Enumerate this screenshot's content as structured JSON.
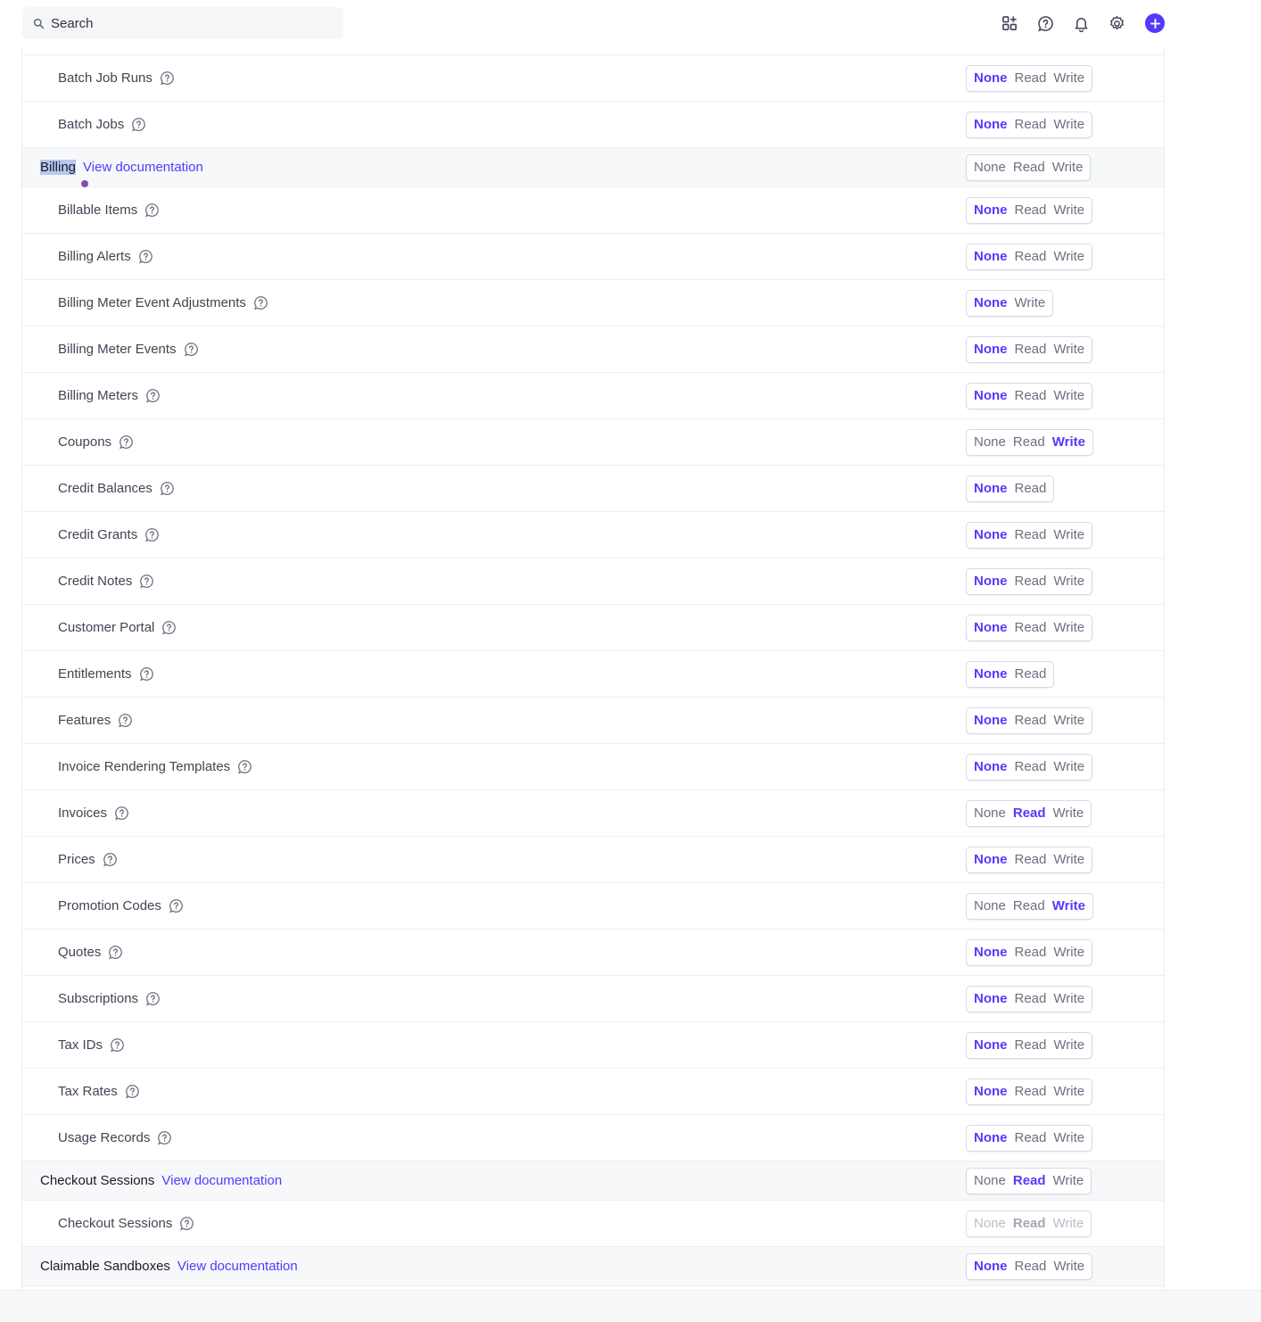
{
  "search": {
    "placeholder": "Search"
  },
  "topbar_icons": [
    "apps-icon",
    "help-icon",
    "bell-icon",
    "gear-icon",
    "plus-icon"
  ],
  "accent_color": "#533afd",
  "rows": [
    {
      "type": "item",
      "label": "Batch Job Runs",
      "options": [
        "None",
        "Read",
        "Write"
      ],
      "selected": "None"
    },
    {
      "type": "item",
      "label": "Batch Jobs",
      "options": [
        "None",
        "Read",
        "Write"
      ],
      "selected": "None"
    },
    {
      "type": "group",
      "label": "Billing",
      "link": "View documentation",
      "options": [
        "None",
        "Read",
        "Write"
      ],
      "selected": "",
      "highlighted": true
    },
    {
      "type": "item",
      "label": "Billable Items",
      "options": [
        "None",
        "Read",
        "Write"
      ],
      "selected": "None"
    },
    {
      "type": "item",
      "label": "Billing Alerts",
      "options": [
        "None",
        "Read",
        "Write"
      ],
      "selected": "None"
    },
    {
      "type": "item",
      "label": "Billing Meter Event Adjustments",
      "options": [
        "None",
        "Write"
      ],
      "selected": "None"
    },
    {
      "type": "item",
      "label": "Billing Meter Events",
      "options": [
        "None",
        "Read",
        "Write"
      ],
      "selected": "None"
    },
    {
      "type": "item",
      "label": "Billing Meters",
      "options": [
        "None",
        "Read",
        "Write"
      ],
      "selected": "None"
    },
    {
      "type": "item",
      "label": "Coupons",
      "options": [
        "None",
        "Read",
        "Write"
      ],
      "selected": "Write"
    },
    {
      "type": "item",
      "label": "Credit Balances",
      "options": [
        "None",
        "Read"
      ],
      "selected": "None"
    },
    {
      "type": "item",
      "label": "Credit Grants",
      "options": [
        "None",
        "Read",
        "Write"
      ],
      "selected": "None"
    },
    {
      "type": "item",
      "label": "Credit Notes",
      "options": [
        "None",
        "Read",
        "Write"
      ],
      "selected": "None"
    },
    {
      "type": "item",
      "label": "Customer Portal",
      "options": [
        "None",
        "Read",
        "Write"
      ],
      "selected": "None"
    },
    {
      "type": "item",
      "label": "Entitlements",
      "options": [
        "None",
        "Read"
      ],
      "selected": "None"
    },
    {
      "type": "item",
      "label": "Features",
      "options": [
        "None",
        "Read",
        "Write"
      ],
      "selected": "None"
    },
    {
      "type": "item",
      "label": "Invoice Rendering Templates",
      "options": [
        "None",
        "Read",
        "Write"
      ],
      "selected": "None"
    },
    {
      "type": "item",
      "label": "Invoices",
      "options": [
        "None",
        "Read",
        "Write"
      ],
      "selected": "Read"
    },
    {
      "type": "item",
      "label": "Prices",
      "options": [
        "None",
        "Read",
        "Write"
      ],
      "selected": "None"
    },
    {
      "type": "item",
      "label": "Promotion Codes",
      "options": [
        "None",
        "Read",
        "Write"
      ],
      "selected": "Write"
    },
    {
      "type": "item",
      "label": "Quotes",
      "options": [
        "None",
        "Read",
        "Write"
      ],
      "selected": "None"
    },
    {
      "type": "item",
      "label": "Subscriptions",
      "options": [
        "None",
        "Read",
        "Write"
      ],
      "selected": "None"
    },
    {
      "type": "item",
      "label": "Tax IDs",
      "options": [
        "None",
        "Read",
        "Write"
      ],
      "selected": "None"
    },
    {
      "type": "item",
      "label": "Tax Rates",
      "options": [
        "None",
        "Read",
        "Write"
      ],
      "selected": "None"
    },
    {
      "type": "item",
      "label": "Usage Records",
      "options": [
        "None",
        "Read",
        "Write"
      ],
      "selected": "None"
    },
    {
      "type": "group",
      "label": "Checkout Sessions",
      "link": "View documentation",
      "options": [
        "None",
        "Read",
        "Write"
      ],
      "selected": "Read"
    },
    {
      "type": "item",
      "label": "Checkout Sessions",
      "options": [
        "None",
        "Read",
        "Write"
      ],
      "selected": "Read",
      "disabled": true
    },
    {
      "type": "group",
      "label": "Claimable Sandboxes",
      "link": "View documentation",
      "options": [
        "None",
        "Read",
        "Write"
      ],
      "selected": "None"
    }
  ]
}
